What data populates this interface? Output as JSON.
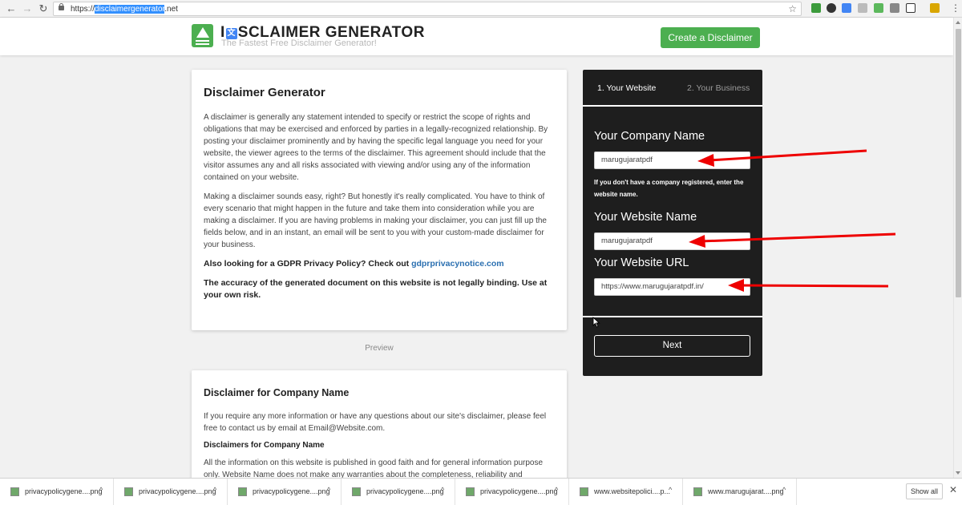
{
  "browser": {
    "url_prefix": "https://",
    "url_highlight": "disclaimergenerator",
    "url_suffix": ".net",
    "back_icon": "←",
    "forward_icon": "→",
    "reload_icon": "↻",
    "star_icon": "☆",
    "menu_icon": "⋮"
  },
  "header": {
    "logo_title_part1": "I",
    "logo_title_part2": "SCLAIMER GENERATOR",
    "logo_title_glyph": "文",
    "tagline": "The Fastest Free Disclaimer Generator!",
    "cta_label": "Create a Disclaimer"
  },
  "intro": {
    "title": "Disclaimer Generator",
    "para1": "A disclaimer is generally any statement intended to specify or restrict the scope of rights and obligations that may be exercised and enforced by parties in a legally-recognized relationship. By posting your disclaimer prominently and by having the specific legal language you need for your website, the viewer agrees to the terms of the disclaimer. This agreement should include that the visitor assumes any and all risks associated with viewing and/or using any of the information contained on your website.",
    "para2": "Making a disclaimer sounds easy, right? But honestly it's really complicated. You have to think of every scenario that might happen in the future and take them into consideration while you are making a disclaimer. If you are having problems in making your disclaimer, you can just fill up the fields below, and in an instant, an email will be sent to you with your custom-made disclaimer for your business.",
    "gdpr_text": "Also looking for a GDPR Privacy Policy? Check out ",
    "gdpr_link": "gdprprivacynotice.com",
    "warning": "The accuracy of the generated document on this website is not legally binding. Use at your own risk."
  },
  "preview_label": "Preview",
  "preview": {
    "title": "Disclaimer for Company Name",
    "para1": "If you require any more information or have any questions about our site's disclaimer, please feel free to contact us by email at Email@Website.com.",
    "subtitle": "Disclaimers for Company Name",
    "para2": "All the information on this website is published in good faith and for general information purpose only. Website Name does not make any warranties about the completeness, reliability and"
  },
  "form": {
    "tab1": "1. Your Website",
    "tab2": "2. Your Business",
    "company_label": "Your Company Name",
    "company_value": "marugujaratpdf",
    "company_help": "If you don't have a company registered, enter the website name.",
    "website_label": "Your Website Name",
    "website_value": "marugujaratpdf",
    "url_label": "Your Website URL",
    "url_value": "https://www.marugujaratpdf.in/",
    "next_label": "Next"
  },
  "downloads": {
    "items": [
      "privacypolicygene....png",
      "privacypolicygene....png",
      "privacypolicygene....png",
      "privacypolicygene....png",
      "privacypolicygene....png",
      "www.websitepolici....p...",
      "www.marugujarat....png"
    ],
    "show_all": "Show all",
    "close_icon": "✕",
    "caret_icon": "^"
  },
  "colors": {
    "accent_green": "#4caf50",
    "panel_bg": "#1e1e1e",
    "arrow_red": "#ee0000",
    "link_blue": "#2a6fb0"
  }
}
